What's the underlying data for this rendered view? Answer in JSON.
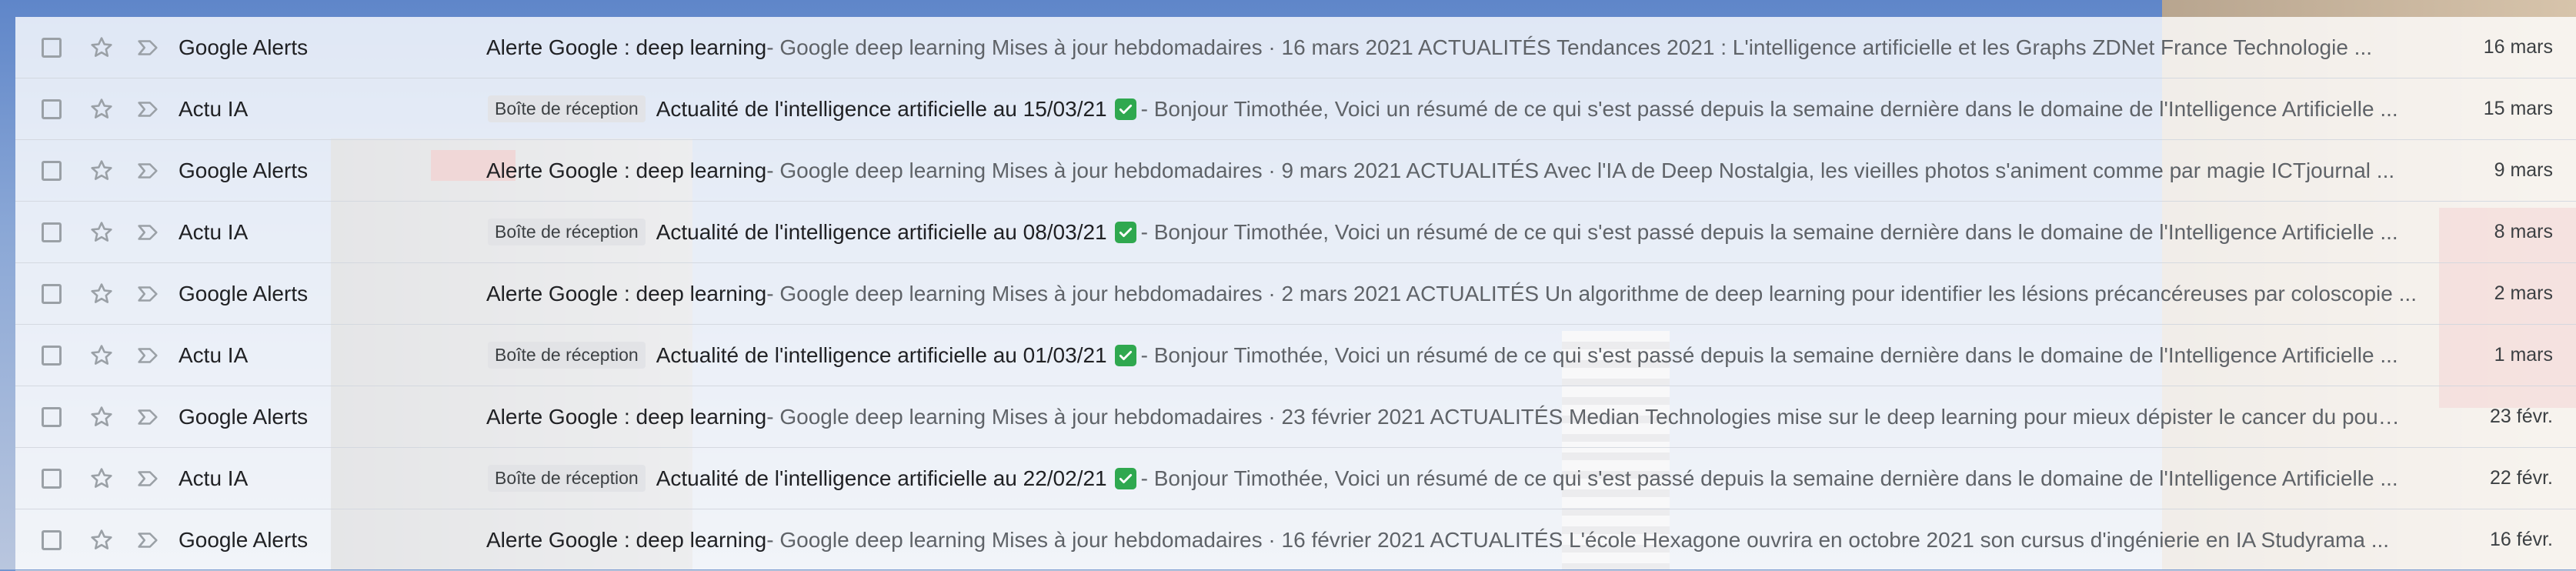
{
  "colors": {
    "accent_check": "#2fa84f",
    "label_bg": "#e1e3e6",
    "snippet_text": "#5f6368"
  },
  "icons": {
    "checkbox": "checkbox-icon",
    "star": "star-icon",
    "importance": "importance-marker-icon",
    "check": "check-mark-icon"
  },
  "emails": [
    {
      "sender": "Google Alerts",
      "label": "",
      "subject": "Alerte Google : deep learning",
      "check": false,
      "snippet": " - Google deep learning Mises à jour hebdomadaires · 16 mars 2021 ACTUALITÉS Tendances 2021 : L'intelligence artificielle et les Graphs ZDNet France Technologie ...",
      "date": "16 mars"
    },
    {
      "sender": "Actu IA",
      "label": "Boîte de réception",
      "subject": "Actualité de l'intelligence artificielle au 15/03/21",
      "check": true,
      "snippet": " - Bonjour Timothée, Voici un résumé de ce qui s'est passé depuis la semaine dernière dans le domaine de l'Intelligence Artificielle ...",
      "date": "15 mars"
    },
    {
      "sender": "Google Alerts",
      "label": "",
      "subject": "Alerte Google : deep learning",
      "check": false,
      "snippet": " - Google deep learning Mises à jour hebdomadaires · 9 mars 2021 ACTUALITÉS Avec l'IA de Deep Nostalgia, les vieilles photos s'animent comme par magie ICTjournal ...",
      "date": "9 mars"
    },
    {
      "sender": "Actu IA",
      "label": "Boîte de réception",
      "subject": "Actualité de l'intelligence artificielle au 08/03/21",
      "check": true,
      "snippet": " - Bonjour Timothée, Voici un résumé de ce qui s'est passé depuis la semaine dernière dans le domaine de l'Intelligence Artificielle ...",
      "date": "8 mars"
    },
    {
      "sender": "Google Alerts",
      "label": "",
      "subject": "Alerte Google : deep learning",
      "check": false,
      "snippet": " - Google deep learning Mises à jour hebdomadaires · 2 mars 2021 ACTUALITÉS Un algorithme de deep learning pour identifier les lésions précancéreuses par coloscopie ...",
      "date": "2 mars"
    },
    {
      "sender": "Actu IA",
      "label": "Boîte de réception",
      "subject": "Actualité de l'intelligence artificielle au 01/03/21",
      "check": true,
      "snippet": " - Bonjour Timothée, Voici un résumé de ce qui s'est passé depuis la semaine dernière dans le domaine de l'Intelligence Artificielle ...",
      "date": "1 mars"
    },
    {
      "sender": "Google Alerts",
      "label": "",
      "subject": "Alerte Google : deep learning",
      "check": false,
      "snippet": " - Google deep learning Mises à jour hebdomadaires · 23 février 2021 ACTUALITÉS Median Technologies mise sur le deep learning pour mieux dépister le cancer du poumon ...",
      "date": "23 févr."
    },
    {
      "sender": "Actu IA",
      "label": "Boîte de réception",
      "subject": "Actualité de l'intelligence artificielle au 22/02/21",
      "check": true,
      "snippet": " - Bonjour Timothée, Voici un résumé de ce qui s'est passé depuis la semaine dernière dans le domaine de l'Intelligence Artificielle ...",
      "date": "22 févr."
    },
    {
      "sender": "Google Alerts",
      "label": "",
      "subject": "Alerte Google : deep learning",
      "check": false,
      "snippet": " - Google deep learning Mises à jour hebdomadaires · 16 février 2021 ACTUALITÉS L'école Hexagone ouvrira en octobre 2021 son cursus d'ingénierie en IA Studyrama ...",
      "date": "16 févr."
    }
  ]
}
